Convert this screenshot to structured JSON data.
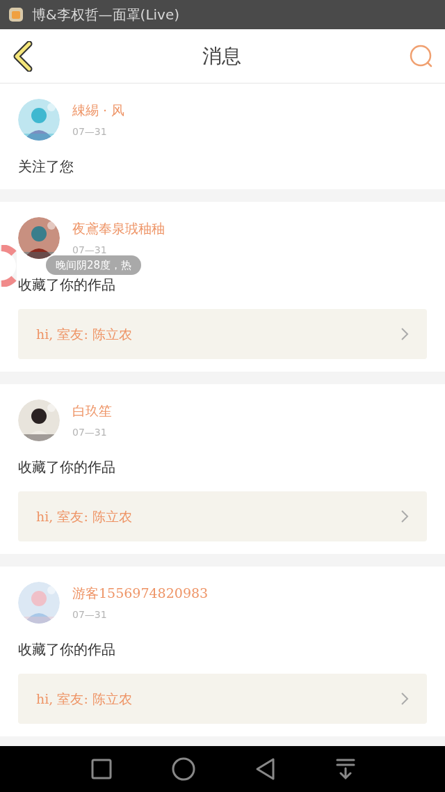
{
  "status_bar": {
    "title": "博&李权哲—面罩(Live)"
  },
  "header": {
    "title": "消息"
  },
  "messages": [
    {
      "name": "綀緆 · 风",
      "date": "07—31",
      "action": "关注了您"
    },
    {
      "name": "夜鳶奉泉珬秞秞",
      "date": "07—31",
      "action": "收藏了你的作品",
      "work": "hi, 室友: 陈立农"
    },
    {
      "name": "白玖笙",
      "date": "07—31",
      "action": "收藏了你的作品",
      "work": "hi, 室友: 陈立农"
    },
    {
      "name": "游客1556974820983",
      "date": "07—31",
      "action": "收藏了你的作品",
      "work": "hi, 室友: 陈立农"
    }
  ],
  "toast": {
    "text": "晚间阴28度，热"
  }
}
